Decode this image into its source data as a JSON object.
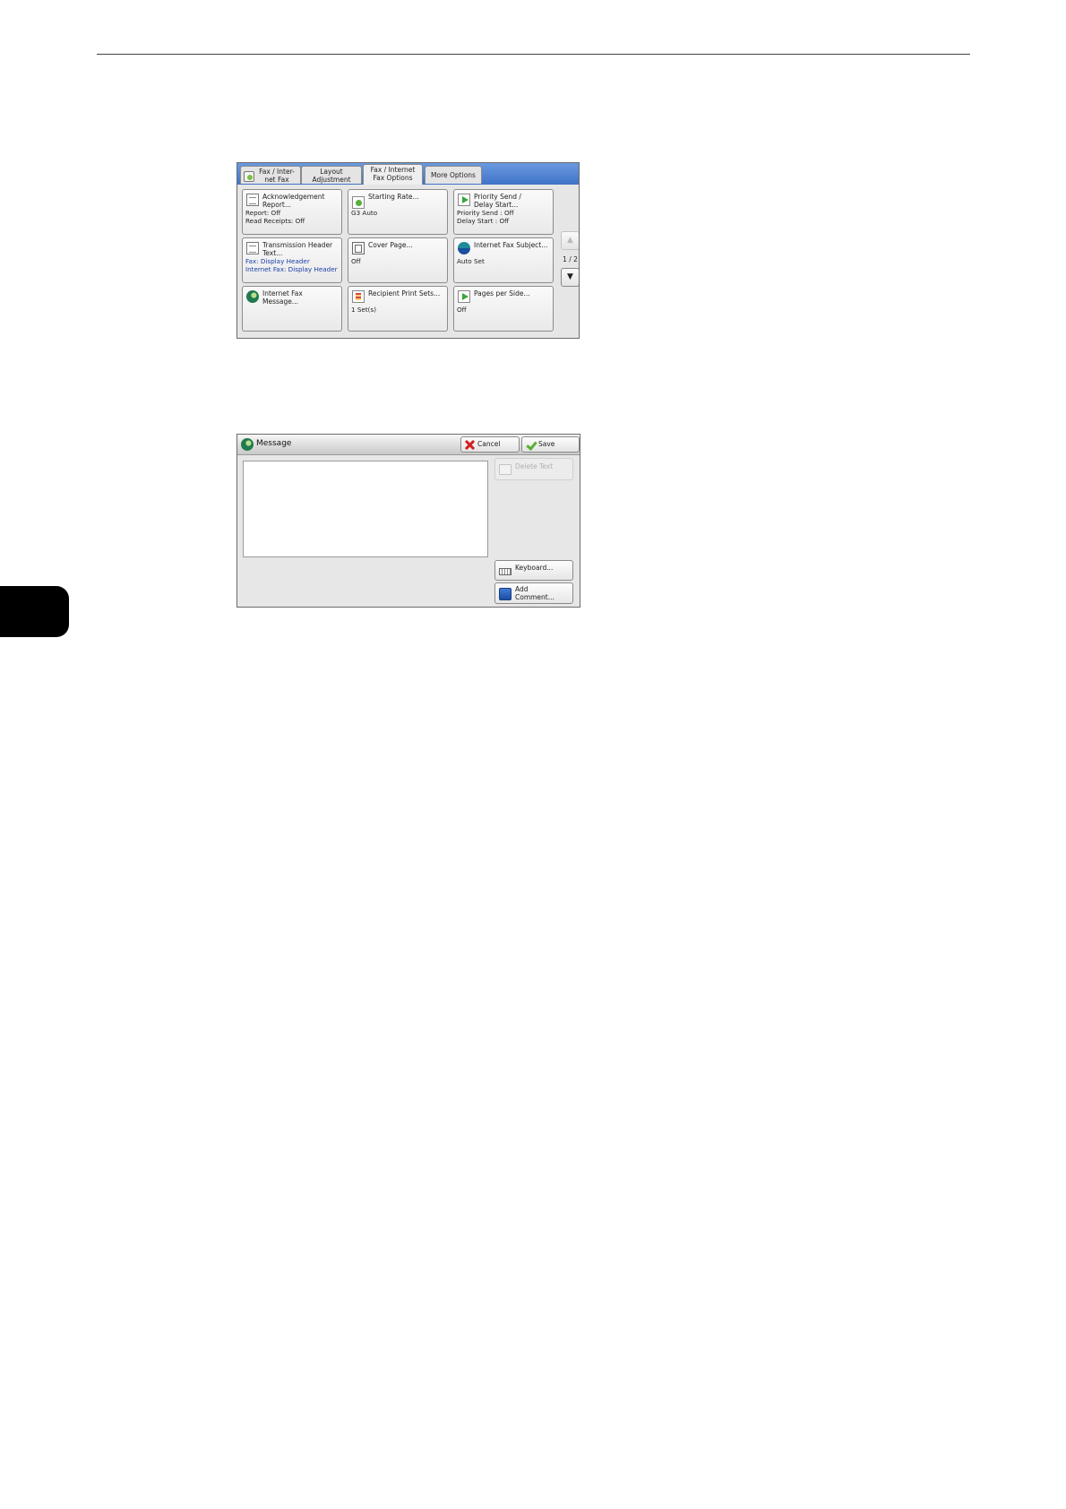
{
  "screen1": {
    "tabs": [
      {
        "label": "Fax / Inter-\nnet Fax"
      },
      {
        "label": "Layout\nAdjustment"
      },
      {
        "label": "Fax / Internet\nFax Options"
      },
      {
        "label": "More Options"
      }
    ],
    "buttons": [
      {
        "label": "Acknowledgement\nReport...",
        "icon": "report-icon",
        "lines": [
          "Report: Off",
          "Read Receipts: Off"
        ]
      },
      {
        "label": "Starting Rate...",
        "icon": "starting-rate-icon",
        "lines": [
          "G3 Auto"
        ]
      },
      {
        "label": "Priority Send /\nDelay Start...",
        "icon": "priority-send-icon",
        "lines": [
          "Priority Send : Off",
          "Delay Start : Off"
        ]
      },
      {
        "label": "Transmission Header\nText...",
        "icon": "header-text-icon",
        "lines": [
          "Fax: Display Header",
          "Internet Fax: Display Header"
        ]
      },
      {
        "label": "Cover Page...",
        "icon": "cover-page-icon",
        "lines": [
          "Off"
        ]
      },
      {
        "label": "Internet Fax Subject...",
        "icon": "subject-globe-icon",
        "lines": [
          "Auto Set"
        ]
      },
      {
        "label": "Internet Fax\nMessage...",
        "icon": "message-globe-icon",
        "lines": []
      },
      {
        "label": "Recipient Print Sets...",
        "icon": "print-sets-icon",
        "lines": [
          "1 Set(s)"
        ]
      },
      {
        "label": "Pages per Side...",
        "icon": "pages-per-side-icon",
        "lines": [
          "Off"
        ]
      }
    ],
    "page_indicator": "1 / 2",
    "scroll_up": "▲",
    "scroll_down": "▼"
  },
  "screen2": {
    "title": "Message",
    "cancel_label": "Cancel",
    "save_label": "Save",
    "message_value": "",
    "delete_label": "Delete Text",
    "keyboard_label": "Keyboard...",
    "add_comment_label": "Add\nComment..."
  }
}
